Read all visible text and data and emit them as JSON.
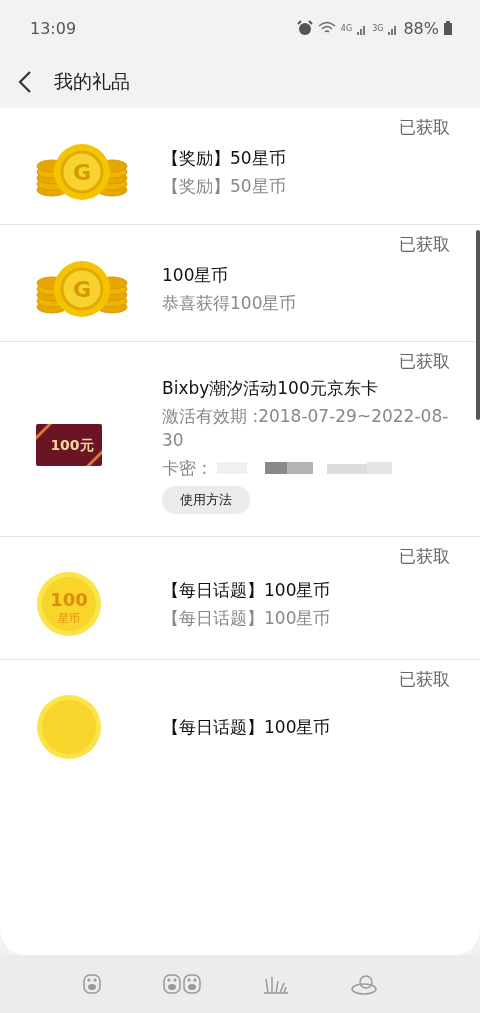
{
  "status_bar": {
    "time": "13:09",
    "net_4g": "4G",
    "net_3g": "3G",
    "battery": "88%"
  },
  "header": {
    "title": "我的礼品"
  },
  "items": [
    {
      "kind": "coins",
      "status": "已获取",
      "title": "【奖励】50星币",
      "subtitle": "【奖励】50星币",
      "icon_text": "G"
    },
    {
      "kind": "coins",
      "status": "已获取",
      "title": "100星币",
      "subtitle": "恭喜获得100星币",
      "icon_text": "G"
    },
    {
      "kind": "card",
      "status": "已获取",
      "title": "Bixby潮汐活动100元京东卡",
      "subtitle": "激活有效期 :2018-07-29~2022-08-30",
      "pin_label": "卡密 :",
      "button": "使用方法",
      "icon_text": "100元"
    },
    {
      "kind": "coin100",
      "status": "已获取",
      "title": "【每日话题】100星币",
      "subtitle": "【每日话题】100星币",
      "icon_text": "100",
      "icon_subtext": "星币"
    },
    {
      "kind": "coin100",
      "status": "已获取",
      "title": "【每日话题】100星币"
    }
  ]
}
